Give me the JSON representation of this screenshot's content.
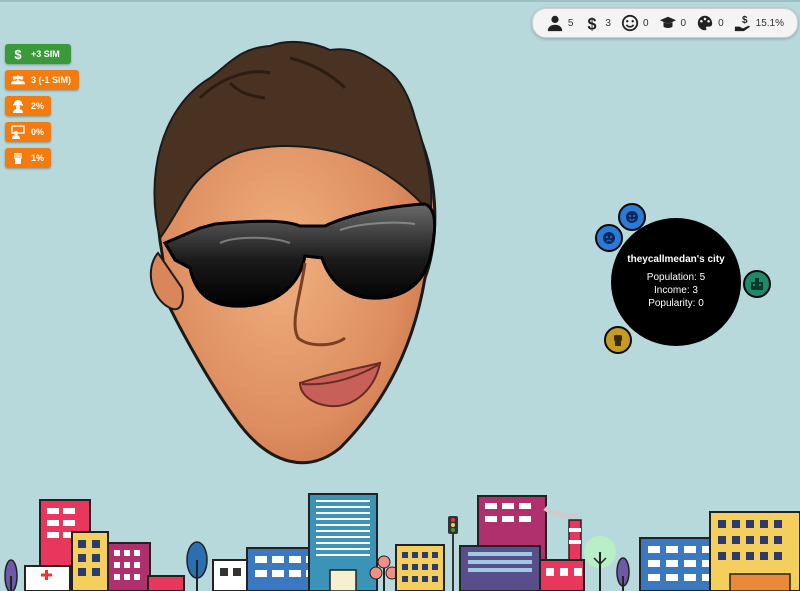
{
  "stats": [
    {
      "icon": "person-icon",
      "value": "5"
    },
    {
      "icon": "dollar-icon",
      "value": "3"
    },
    {
      "icon": "smile-icon",
      "value": "0"
    },
    {
      "icon": "graduation-cap-icon",
      "value": "0"
    },
    {
      "icon": "palette-icon",
      "value": "0"
    },
    {
      "icon": "hand-money-icon",
      "value": "15.1%"
    }
  ],
  "pills": [
    {
      "icon": "dollar-icon",
      "label": "+3 SIM",
      "color": "#3a9a3a"
    },
    {
      "icon": "people-icon",
      "label": "3 (-1 SIM)",
      "color": "#f47b0e"
    },
    {
      "icon": "factory-worker-icon",
      "label": "2%",
      "color": "#f47b0e"
    },
    {
      "icon": "teacher-icon",
      "label": "0%",
      "color": "#f47b0e"
    },
    {
      "icon": "fist-icon",
      "label": "1%",
      "color": "#f47b0e"
    }
  ],
  "city": {
    "name": "theycallmedan's city",
    "population": "Population: 5",
    "income": "Income: 3",
    "popularity": "Popularity: 0"
  },
  "colors": {
    "background": "#b8d9dc",
    "blue_bubble": "#2a7ad6",
    "teal_bubble": "#1f8a6a",
    "gold_bubble": "#c79a22"
  }
}
